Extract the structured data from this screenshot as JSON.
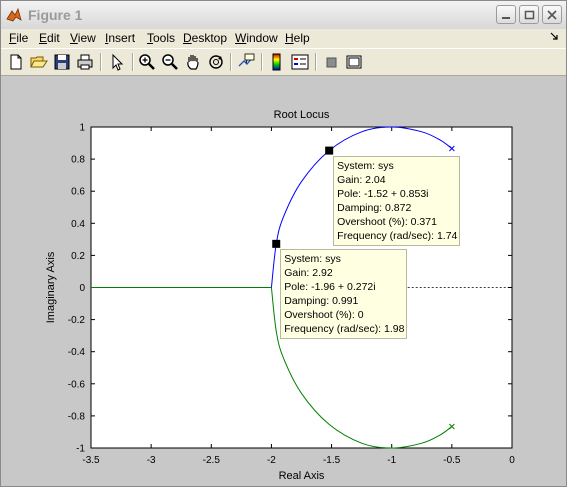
{
  "window": {
    "title": "Figure 1"
  },
  "menu": [
    {
      "label": "File",
      "key": "F",
      "rest": "ile"
    },
    {
      "label": "Edit",
      "key": "E",
      "rest": "dit"
    },
    {
      "label": "View",
      "key": "V",
      "rest": "iew"
    },
    {
      "label": "Insert",
      "key": "I",
      "rest": "nsert"
    },
    {
      "label": "Tools",
      "key": "T",
      "rest": "ools"
    },
    {
      "label": "Desktop",
      "key": "D",
      "rest": "esktop"
    },
    {
      "label": "Window",
      "key": "W",
      "rest": "indow"
    },
    {
      "label": "Help",
      "key": "H",
      "rest": "elp"
    }
  ],
  "toolbar": [
    "new-figure",
    "open-file",
    "save-figure",
    "print-figure",
    "edit-plot",
    "zoom-in",
    "zoom-out",
    "pan",
    "rotate-3d",
    "data-cursor",
    "insert-colorbar",
    "insert-legend",
    "hide-plot-tools",
    "show-plot-tools"
  ],
  "colors": {
    "branch_upper": "#0000ff",
    "branch_lower": "#008000",
    "tooltip_bg": "#ffffe1",
    "background": "#c8c8c8"
  },
  "chart_data": {
    "type": "line",
    "title": "Root Locus",
    "xlabel": "Real Axis",
    "ylabel": "Imaginary Axis",
    "xlim": [
      -3.5,
      0
    ],
    "ylim": [
      -1,
      1
    ],
    "xticks": [
      "-3.5",
      "-3",
      "-2.5",
      "-2",
      "-1.5",
      "-1",
      "-0.5",
      "0"
    ],
    "yticks": [
      "1",
      "0.8",
      "0.6",
      "0.4",
      "0.2",
      "0",
      "-0.2",
      "-0.4",
      "-0.6",
      "-0.8",
      "-1"
    ],
    "grid": false,
    "series": [
      {
        "color": "#0000ff",
        "points": [
          [
            -0.5,
            0.866
          ],
          [
            -0.6,
            0.92
          ],
          [
            -0.75,
            0.97
          ],
          [
            -1.0,
            1.0
          ],
          [
            -1.25,
            0.97
          ],
          [
            -1.52,
            0.853
          ],
          [
            -1.75,
            0.66
          ],
          [
            -1.9,
            0.44
          ],
          [
            -1.96,
            0.272
          ],
          [
            -2.0,
            0.0
          ]
        ]
      },
      {
        "color": "#008000",
        "points": [
          [
            -0.5,
            -0.866
          ],
          [
            -0.6,
            -0.92
          ],
          [
            -0.75,
            -0.97
          ],
          [
            -1.0,
            -1.0
          ],
          [
            -1.25,
            -0.97
          ],
          [
            -1.52,
            -0.853
          ],
          [
            -1.75,
            -0.66
          ],
          [
            -1.9,
            -0.44
          ],
          [
            -1.96,
            -0.272
          ],
          [
            -2.0,
            0.0
          ]
        ]
      },
      {
        "color": "#008000",
        "points": [
          [
            -2.0,
            0.0
          ],
          [
            -3.5,
            0.0
          ]
        ]
      }
    ],
    "poles": [
      [
        -0.5,
        0.866
      ],
      [
        -0.5,
        -0.866
      ]
    ],
    "dashed_axis": [
      [
        -1.0,
        0.0
      ],
      [
        0.0,
        0.0
      ]
    ],
    "markers": [
      [
        -1.52,
        0.853
      ],
      [
        -1.96,
        0.272
      ]
    ],
    "datatips": [
      {
        "x": -1.52,
        "y": 0.853,
        "lines": [
          "System: sys",
          "Gain: 2.04",
          "Pole: -1.52 + 0.853i",
          "Damping: 0.872",
          "Overshoot (%): 0.371",
          "Frequency (rad/sec): 1.74"
        ]
      },
      {
        "x": -1.96,
        "y": 0.272,
        "lines": [
          "System: sys",
          "Gain: 2.92",
          "Pole: -1.96 + 0.272i",
          "Damping: 0.991",
          "Overshoot (%): 0",
          "Frequency (rad/sec): 1.98"
        ]
      }
    ]
  }
}
